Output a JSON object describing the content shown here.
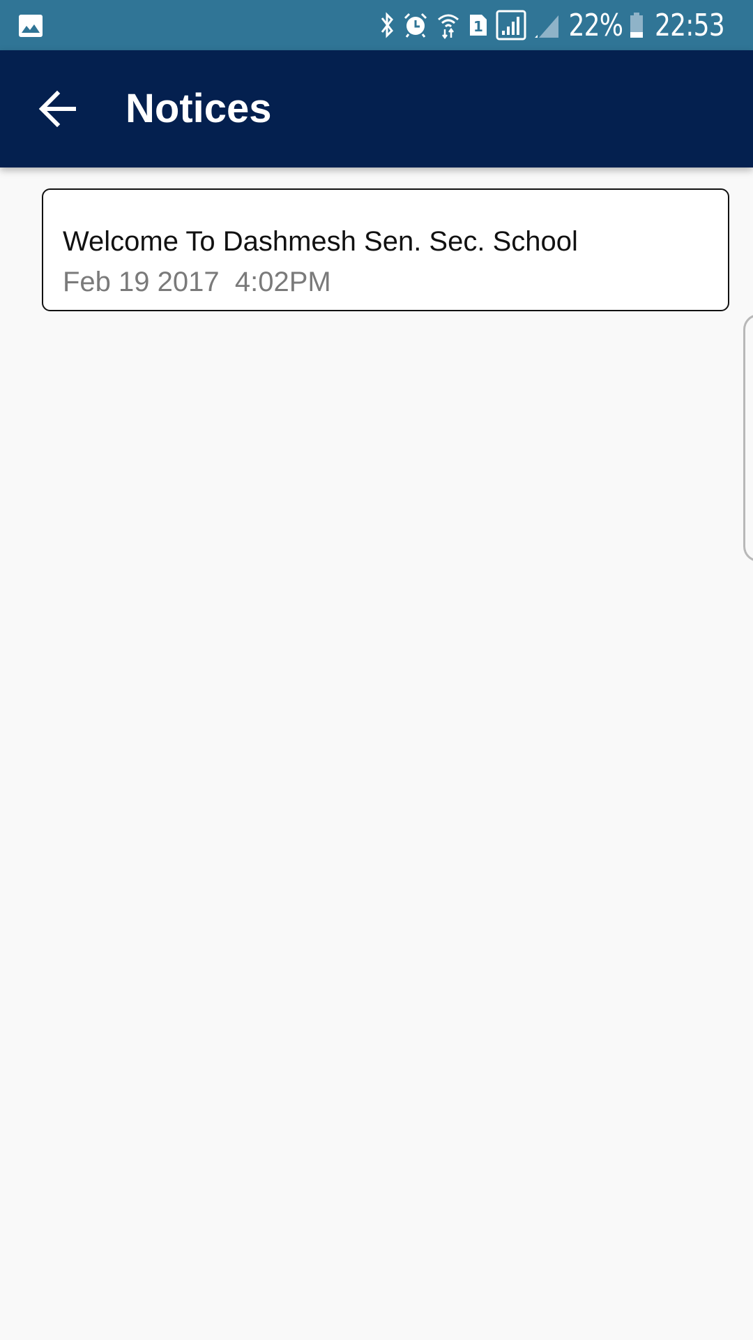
{
  "status_bar": {
    "notification_icon": "image-icon",
    "icons": [
      "bluetooth-icon",
      "alarm-icon",
      "wifi-data-icon",
      "sim-1-icon",
      "signal-icon",
      "signal-weak-icon"
    ],
    "battery_percent": "22%",
    "battery_icon": "battery-icon",
    "time": "22:53"
  },
  "toolbar": {
    "back_icon": "arrow-left-icon",
    "title": "Notices"
  },
  "notices": [
    {
      "title": "Welcome To Dashmesh Sen. Sec. School",
      "date": "Feb 19 2017  4:02PM"
    }
  ],
  "colors": {
    "status_bar": "#307596",
    "toolbar": "#04204f",
    "background": "#f9f9f9",
    "date_text": "#7a7a7a"
  }
}
